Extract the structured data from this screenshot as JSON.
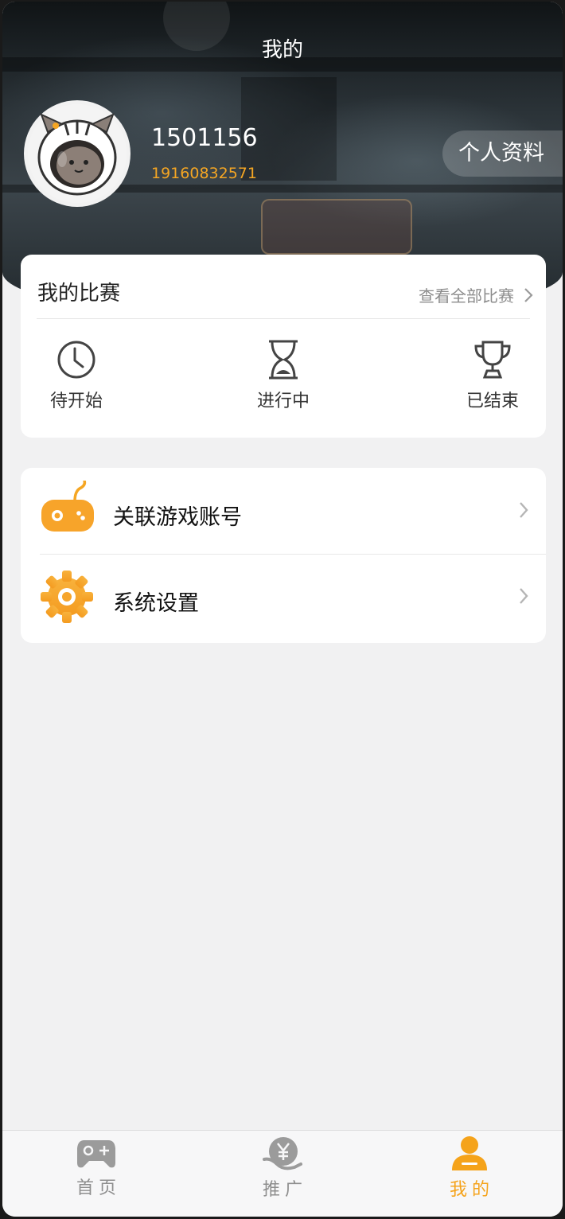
{
  "header": {
    "title": "我的",
    "user_id": "1501156",
    "phone": "19160832571",
    "profile_button": "个人资料"
  },
  "match": {
    "title": "我的比赛",
    "view_all": "查看全部比赛",
    "statuses": [
      {
        "label": "待开始",
        "icon": "clock-icon"
      },
      {
        "label": "进行中",
        "icon": "hourglass-icon"
      },
      {
        "label": "已结束",
        "icon": "trophy-icon"
      }
    ]
  },
  "menu": {
    "items": [
      {
        "label": "关联游戏账号",
        "icon": "gamepad-icon"
      },
      {
        "label": "系统设置",
        "icon": "settings-gear-icon"
      }
    ]
  },
  "tabbar": {
    "items": [
      {
        "label": "首页",
        "icon": "gamepad-tab-icon",
        "active": false
      },
      {
        "label": "推广",
        "icon": "promote-yen-icon",
        "active": false
      },
      {
        "label": "我的",
        "icon": "person-icon",
        "active": true
      }
    ]
  },
  "colors": {
    "accent": "#f5a623",
    "active_tab": "#f5a31b",
    "background": "#f1f1f2"
  }
}
